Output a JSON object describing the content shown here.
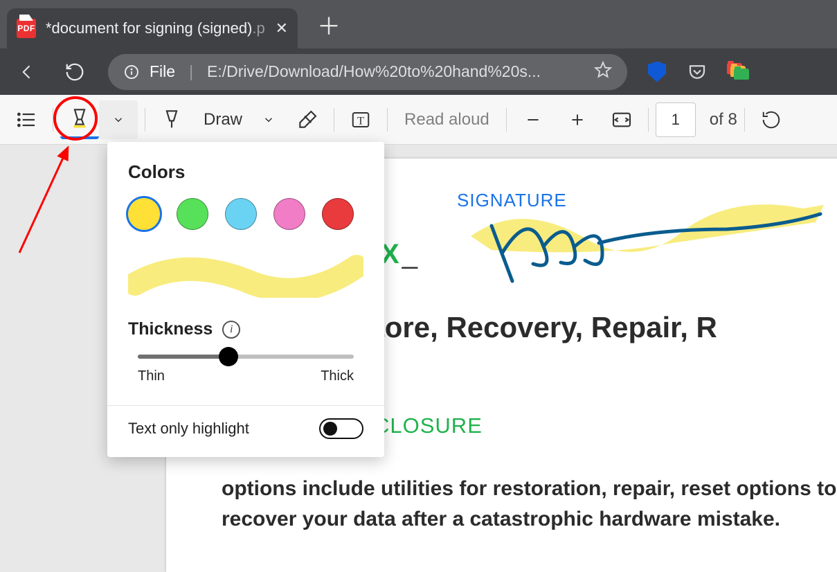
{
  "tab": {
    "title": "*document for signing (signed)",
    "title_trunc": ".p",
    "icon_label": "PDF"
  },
  "address": {
    "scheme_label": "File",
    "path": "E:/Drive/Download/How%20to%20hand%20s..."
  },
  "toolbar": {
    "draw_label": "Draw",
    "read_aloud": "Read aloud",
    "page_current": "1",
    "page_total": "of 8"
  },
  "popup": {
    "colors_heading": "Colors",
    "thickness_heading": "Thickness",
    "slider_min_label": "Thin",
    "slider_max_label": "Thick",
    "slider_value": 0.42,
    "toggle_label": "Text only highlight",
    "toggle_on": false,
    "colors": [
      {
        "hex": "#ffe037",
        "selected": true
      },
      {
        "hex": "#57e15a",
        "selected": false
      },
      {
        "hex": "#6ad3f4",
        "selected": false
      },
      {
        "hex": "#f07dc6",
        "selected": false
      },
      {
        "hex": "#e93a3d",
        "selected": false
      }
    ]
  },
  "document": {
    "signature_label": "SIGNATURE",
    "x_mark": "X",
    "underline_after_x": "_",
    "heading": "ackup, Restore, Recovery, Repair, R",
    "closure": "CLOSURE",
    "body": "options include utilities for restoration, repair, reset options to recover your data after a catastrophic hardware mistake."
  }
}
